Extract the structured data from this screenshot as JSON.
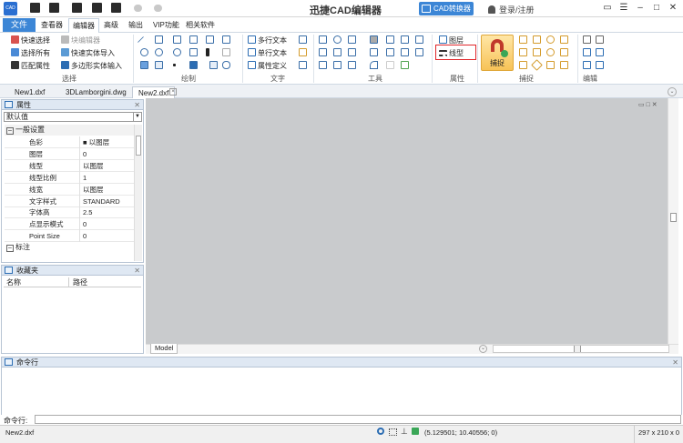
{
  "app": {
    "title": "迅捷CAD编辑器",
    "logo_text": "CAD",
    "converter_label": "CAD转换器",
    "login_label": "登录/注册",
    "accent": "#3c86d6"
  },
  "window_controls": {
    "minimize": "–",
    "maximize": "□",
    "close": "✕",
    "menu": "☰",
    "screen": "▭"
  },
  "menu": {
    "file": "文件",
    "items": [
      "查看器",
      "编辑器",
      "高级",
      "输出",
      "VIP功能",
      "相关软件"
    ],
    "active": "编辑器"
  },
  "ribbon": {
    "select": {
      "group": "选择",
      "items": [
        "快速选择",
        "选择所有",
        "匹配属性",
        "块编辑器",
        "快速实体导入",
        "多边形实体输入"
      ]
    },
    "draw": {
      "group": "绘制"
    },
    "text": {
      "group": "文字",
      "items": [
        "多行文本",
        "单行文本",
        "属性定义"
      ]
    },
    "tools": {
      "group": "工具"
    },
    "props": {
      "group": "属性",
      "items": [
        "图层",
        "线型"
      ]
    },
    "snap": {
      "group": "捕捉",
      "big_label": "捕捉"
    },
    "edit": {
      "group": "编辑"
    }
  },
  "tabs": [
    "New1.dxf",
    "3DLamborgini.dwg",
    "New2.dxf"
  ],
  "active_tab": "New2.dxf",
  "properties": {
    "title": "属性",
    "dropdown_value": "默认值",
    "section1": "一般设置",
    "section2": "标注",
    "rows": [
      {
        "k": "色彩",
        "v": "■ 以图层"
      },
      {
        "k": "图层",
        "v": "0"
      },
      {
        "k": "线型",
        "v": "以图层"
      },
      {
        "k": "线型比例",
        "v": "1"
      },
      {
        "k": "线宽",
        "v": "以图层"
      },
      {
        "k": "文字样式",
        "v": "STANDARD"
      },
      {
        "k": "字体高",
        "v": "2.5"
      },
      {
        "k": "点显示模式",
        "v": "0"
      },
      {
        "k": "Point Size",
        "v": "0"
      }
    ]
  },
  "favorites": {
    "title": "收藏夹",
    "col_name": "名称",
    "col_path": "路径"
  },
  "canvas": {
    "model_tab": "Model",
    "bg": "#c9cbcd"
  },
  "command": {
    "title": "命令行",
    "prompt": "命令行:"
  },
  "status": {
    "file": "New2.dxf",
    "coords": "(5.129501; 10.40556; 0)",
    "paper": "297 x 210 x 0"
  }
}
